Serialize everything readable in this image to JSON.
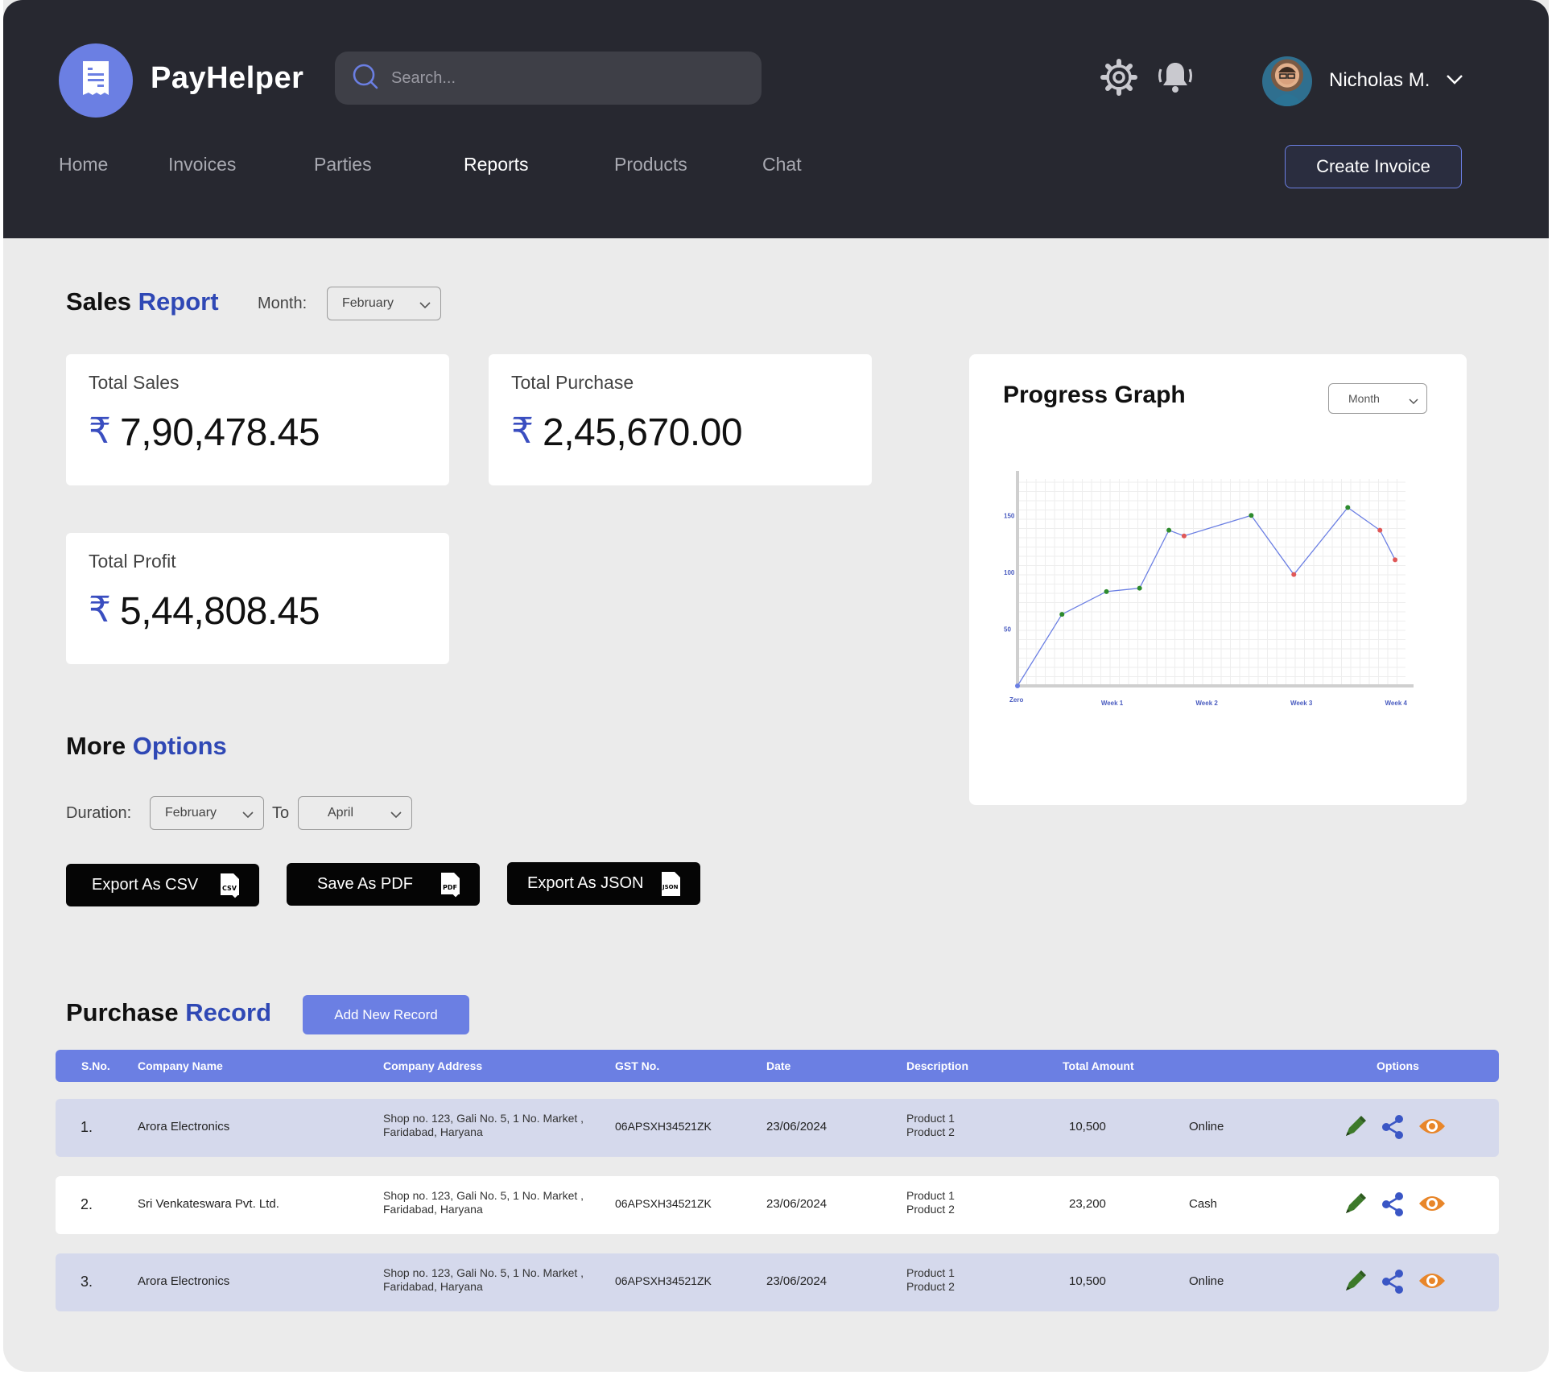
{
  "app": {
    "brand": "PayHelper"
  },
  "search": {
    "placeholder": "Search..."
  },
  "user": {
    "name": "Nicholas M."
  },
  "nav": [
    "Home",
    "Invoices",
    "Parties",
    "Reports",
    "Products",
    "Chat"
  ],
  "nav_active": "Reports",
  "header": {
    "create_invoice": "Create Invoice"
  },
  "sales_report": {
    "title_main": "Sales",
    "title_accent": "Report",
    "month_label": "Month:",
    "month_value": "February",
    "currency_symbol": "₹",
    "cards": [
      {
        "label": "Total Sales",
        "value": "7,90,478.45"
      },
      {
        "label": "Total Purchase",
        "value": "2,45,670.00"
      },
      {
        "label": "Total Profit",
        "value": "5,44,808.45"
      }
    ]
  },
  "progress_graph": {
    "title": "Progress Graph",
    "period_value": "Month"
  },
  "chart_data": {
    "type": "line",
    "title": "Progress Graph",
    "y_ticks": [
      "Zero",
      "50",
      "100",
      "150"
    ],
    "x_ticks": [
      "Week 1",
      "Week 2",
      "Week 3",
      "Week 4"
    ],
    "ylim": [
      0,
      175
    ],
    "xlim": [
      0,
      4.1
    ],
    "grid": true,
    "series": [
      {
        "points": [
          {
            "x": 0,
            "y": 0,
            "status": "start"
          },
          {
            "x": 0.47,
            "y": 63,
            "status": "up"
          },
          {
            "x": 0.94,
            "y": 83,
            "status": "up"
          },
          {
            "x": 1.29,
            "y": 86,
            "status": "up"
          },
          {
            "x": 1.6,
            "y": 137,
            "status": "up"
          },
          {
            "x": 1.76,
            "y": 132,
            "status": "down"
          },
          {
            "x": 2.47,
            "y": 150,
            "status": "up"
          },
          {
            "x": 2.92,
            "y": 98,
            "status": "down"
          },
          {
            "x": 3.49,
            "y": 157,
            "status": "up"
          },
          {
            "x": 3.83,
            "y": 137,
            "status": "down"
          },
          {
            "x": 3.99,
            "y": 111,
            "status": "down"
          }
        ]
      }
    ],
    "colors": {
      "line": "#6b7fe3",
      "up": "#2e8b2e",
      "down": "#e05858",
      "start": "#6b7fe3"
    }
  },
  "more_options": {
    "title_main": "More",
    "title_accent": "Options",
    "duration_label": "Duration:",
    "from_value": "February",
    "to_label": "To",
    "to_value": "April",
    "export_csv": "Export As CSV",
    "save_pdf": "Save As PDF",
    "export_json": "Export As JSON"
  },
  "purchase_record": {
    "title_main": "Purchase",
    "title_accent": "Record",
    "add_button": "Add New Record",
    "columns": [
      "S.No.",
      "Company Name",
      "Company  Address",
      "GST No.",
      "Date",
      "Description",
      "Total Amount",
      "Options"
    ],
    "rows": [
      {
        "sno": "1.",
        "company": "Arora Electronics",
        "address_line1": "Shop no. 123, Gali No. 5, 1 No. Market ,",
        "address_line2": "Faridabad, Haryana",
        "gst": "06APSXH34521ZK",
        "date": "23/06/2024",
        "desc_line1": "Product 1",
        "desc_line2": "Product 2",
        "amount": "10,500",
        "payment": "Online"
      },
      {
        "sno": "2.",
        "company": "Sri Venkateswara Pvt. Ltd.",
        "address_line1": "Shop no. 123, Gali No. 5, 1 No. Market ,",
        "address_line2": "Faridabad, Haryana",
        "gst": "06APSXH34521ZK",
        "date": "23/06/2024",
        "desc_line1": "Product 1",
        "desc_line2": "Product 2",
        "amount": "23,200",
        "payment": "Cash"
      },
      {
        "sno": "3.",
        "company": "Arora Electronics",
        "address_line1": "Shop no. 123, Gali No. 5, 1 No. Market ,",
        "address_line2": "Faridabad, Haryana",
        "gst": "06APSXH34521ZK",
        "date": "23/06/2024",
        "desc_line1": "Product 1",
        "desc_line2": "Product 2",
        "amount": "10,500",
        "payment": "Online"
      }
    ]
  },
  "icons": {
    "logo": "receipt-icon",
    "search": "search-icon",
    "settings": "gear-icon",
    "notifications": "bell-icon",
    "user_menu": "chevron-down-icon",
    "row_options": [
      "edit-icon",
      "share-icon",
      "view-icon"
    ]
  },
  "colors": {
    "header_bg": "#272830",
    "accent": "#6b7fe3",
    "accent_text": "#2f48b5",
    "page_bg": "#ebebeb",
    "row_shade": "#d5d9ec",
    "edit": "#3d7a2a",
    "share": "#3a56c5",
    "view": "#e8862a"
  }
}
